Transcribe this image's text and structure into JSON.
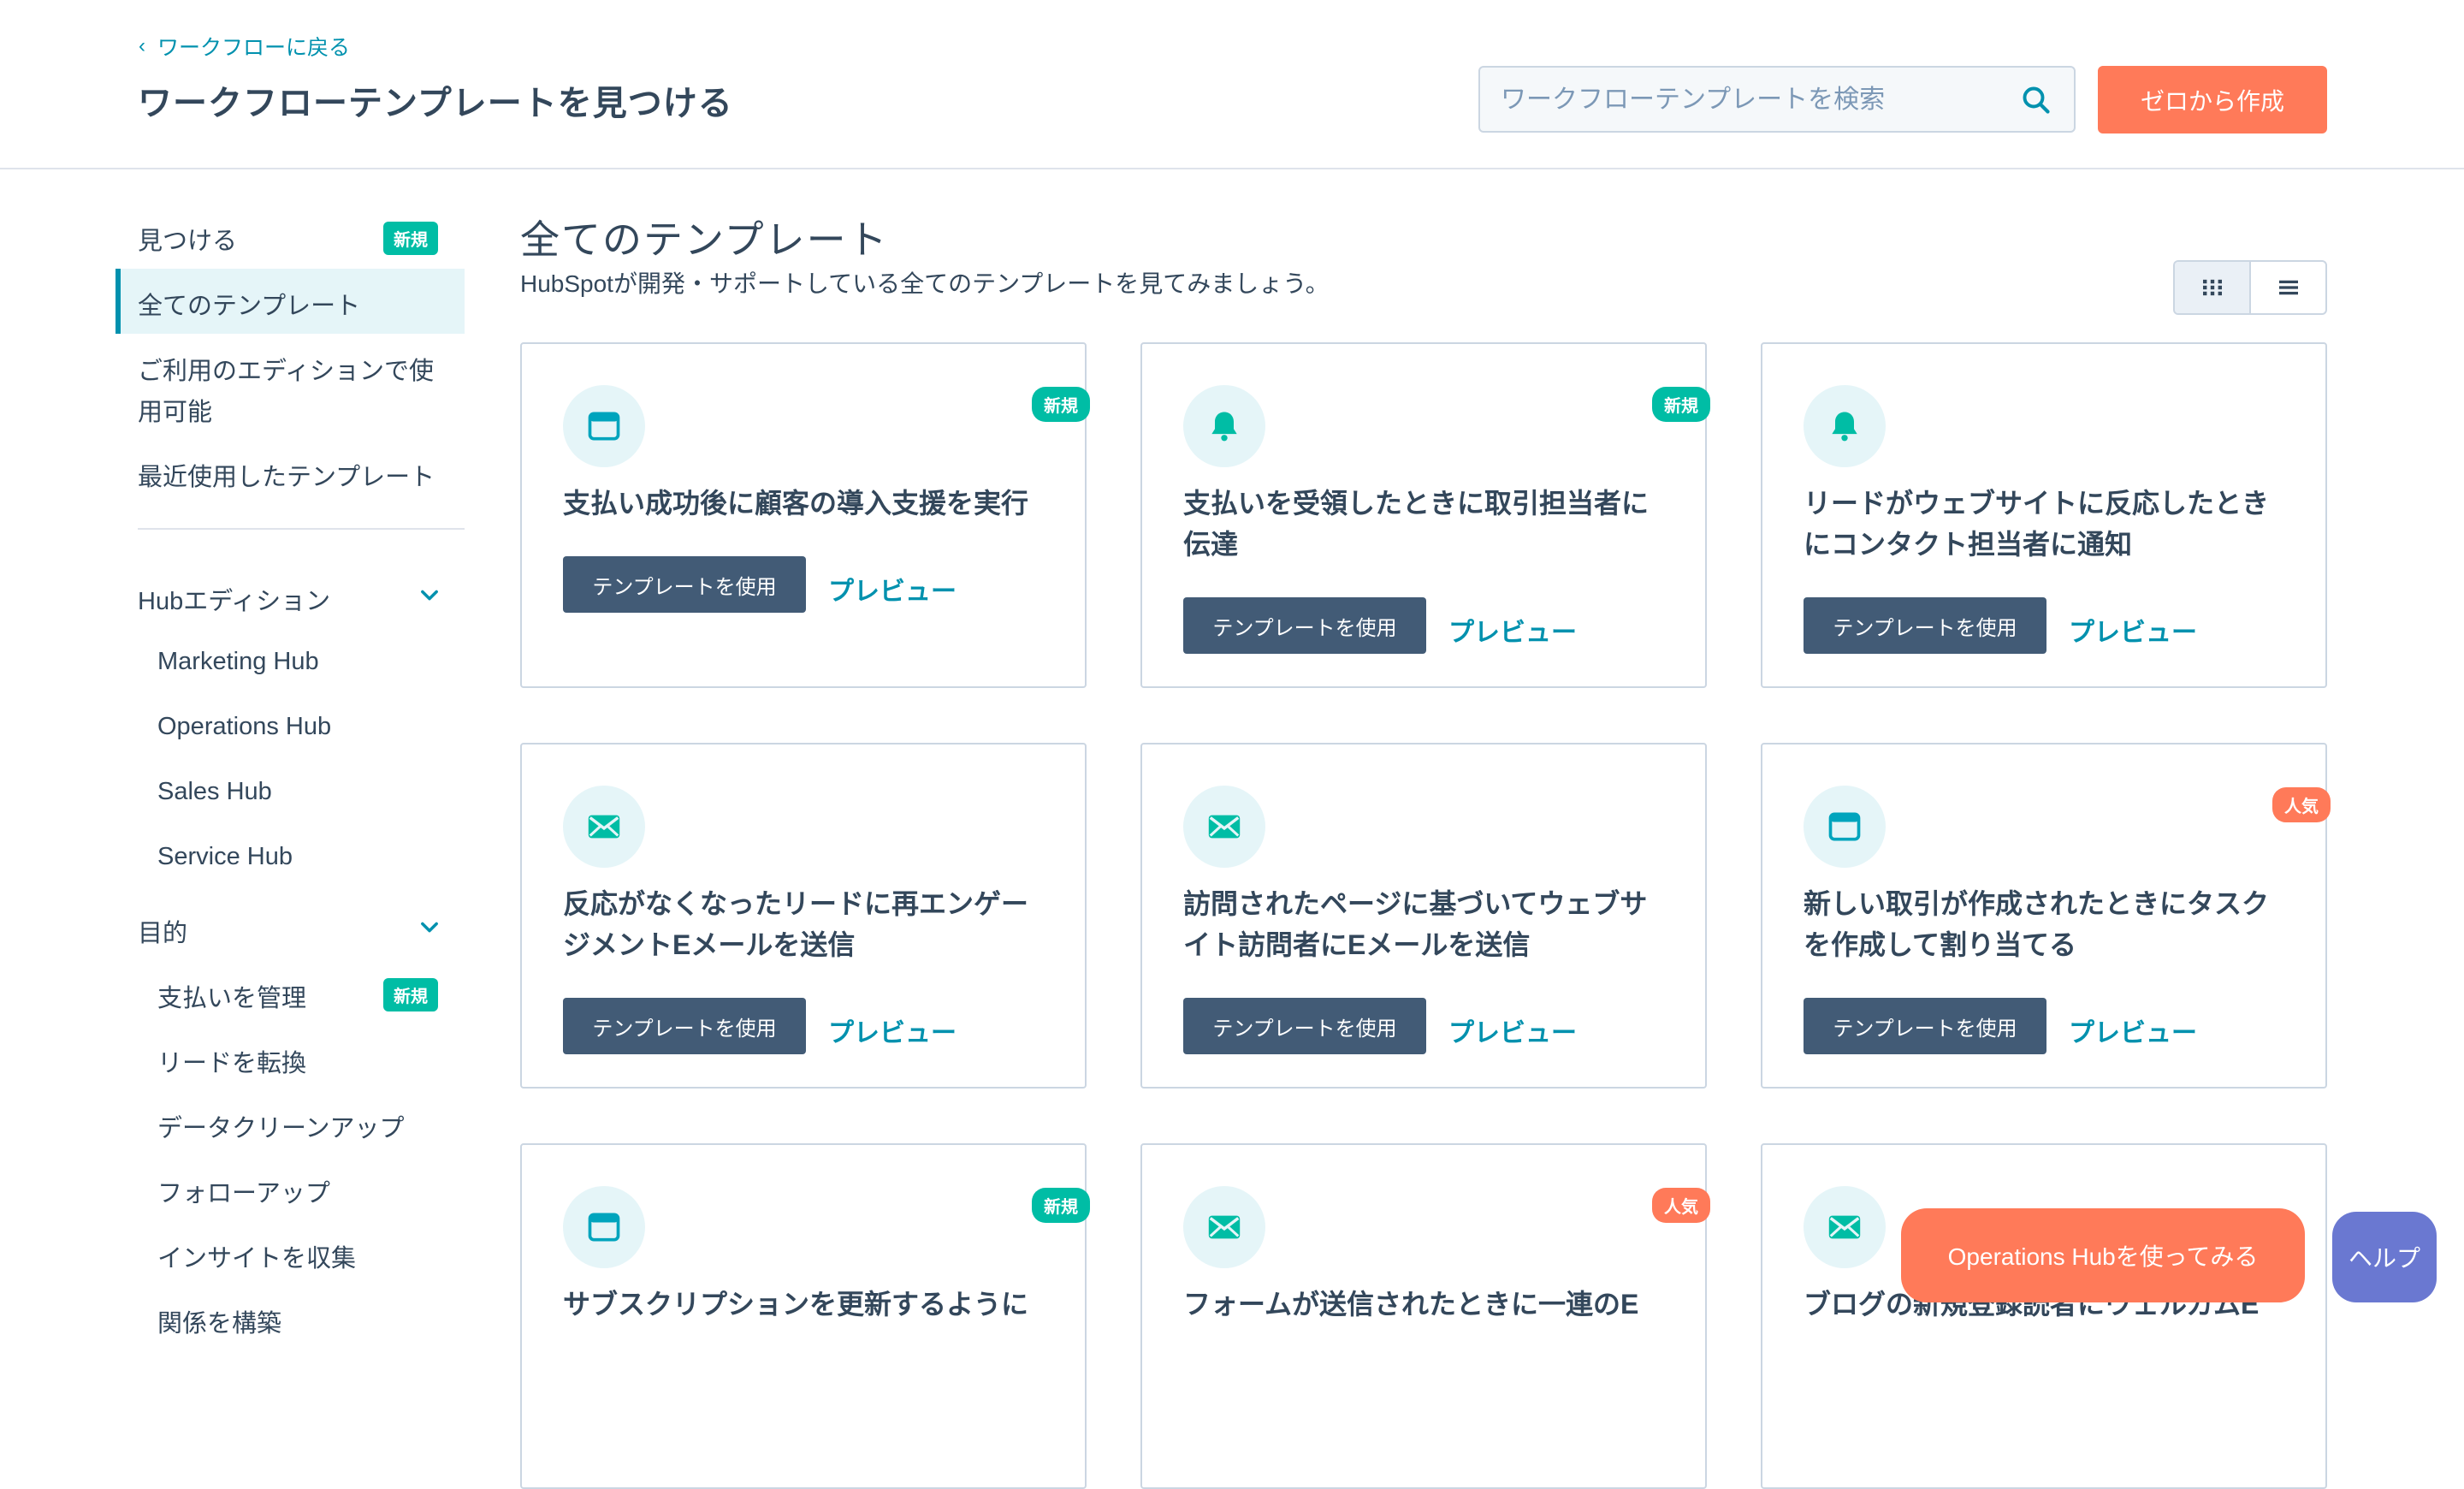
{
  "header": {
    "back_label": "ワークフローに戻る",
    "title": "ワークフローテンプレートを見つける",
    "search_placeholder": "ワークフローテンプレートを検索",
    "create_label": "ゼロから作成"
  },
  "sidebar": {
    "top_items": [
      {
        "label": "見つける",
        "badge": "新規"
      },
      {
        "label": "全てのテンプレート",
        "active": true
      },
      {
        "label": "ご利用のエディションで使用可能",
        "line1": "ご利用のエディションで使",
        "line2": "用可能"
      },
      {
        "label": "最近使用したテンプレート"
      }
    ],
    "hub_section": {
      "label": "Hubエディション",
      "items": [
        "Marketing Hub",
        "Operations Hub",
        "Sales Hub",
        "Service Hub"
      ]
    },
    "goal_section": {
      "label": "目的",
      "items": [
        {
          "label": "支払いを管理",
          "badge": "新規"
        },
        {
          "label": "リードを転換"
        },
        {
          "label": "データクリーンアップ"
        },
        {
          "label": "フォローアップ"
        },
        {
          "label": "インサイトを収集"
        },
        {
          "label": "関係を構築"
        }
      ]
    }
  },
  "main": {
    "title": "全てのテンプレート",
    "subtitle": "HubSpotが開発・サポートしている全てのテンプレートを見てみましょう。",
    "use_label": "テンプレートを使用",
    "preview_label": "プレビュー",
    "cards": [
      {
        "line1": "支払い成功後に顧客の導入支援を実行",
        "line2": "",
        "badge": "新規",
        "icon": "browser-window-icon"
      },
      {
        "line1": "支払いを受領したときに取引担当者に",
        "line2": "伝達",
        "badge": "新規",
        "icon": "bell-icon"
      },
      {
        "line1": "リードがウェブサイトに反応したとき",
        "line2": "にコンタクト担当者に通知",
        "badge": "",
        "icon": "bell-icon"
      },
      {
        "line1": "反応がなくなったリードに再エンゲー",
        "line2": "ジメントEメールを送信",
        "badge": "",
        "icon": "envelope-icon"
      },
      {
        "line1": "訪問されたページに基づいてウェブサ",
        "line2": "イト訪問者にEメールを送信",
        "badge": "",
        "icon": "envelope-icon"
      },
      {
        "line1": "新しい取引が作成されたときにタスク",
        "line2": "を作成して割り当てる",
        "badge": "人気",
        "icon": "browser-window-icon"
      },
      {
        "line1": "サブスクリプションを更新するように",
        "line2": "",
        "badge": "新規",
        "icon": "browser-window-icon"
      },
      {
        "line1": "フォームが送信されたときに一連のE",
        "line2": "",
        "badge": "人気",
        "icon": "envelope-icon"
      },
      {
        "line1": "ブログの新規登録読者にウェルカムE",
        "line2": "",
        "badge": "",
        "icon": "envelope-icon"
      }
    ]
  },
  "floating": {
    "try_label": "Operations Hubを使ってみる",
    "help_label": "ヘルプ"
  },
  "colors": {
    "accent_orange": "#ff7a59",
    "teal": "#00bda5",
    "link_blue": "#0091ae",
    "dark_button": "#425b76",
    "help_purple": "#6a78d1"
  }
}
